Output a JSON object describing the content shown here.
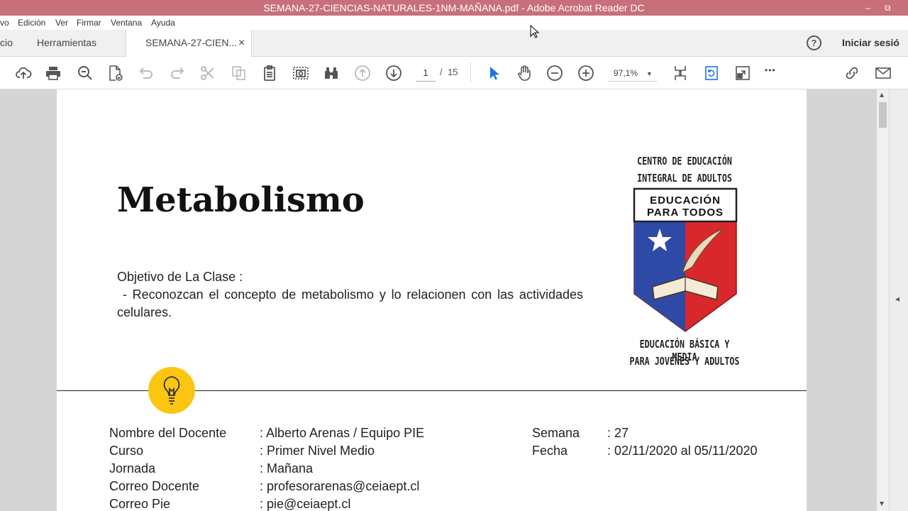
{
  "window": {
    "title": "SEMANA-27-CIENCIAS-NATURALES-1NM-MAÑANA.pdf - Adobe Acrobat Reader DC",
    "minimize_glyph": "–",
    "restore_glyph": "⧉"
  },
  "menu": {
    "items": [
      "vo",
      "Edición",
      "Ver",
      "Firmar",
      "Ventana",
      "Ayuda"
    ]
  },
  "tabs": {
    "home": "cio",
    "tools": "Herramientas",
    "doc": "SEMANA-27-CIEN...",
    "close_glyph": "×",
    "help_glyph": "?",
    "signin": "Iniciar sesió"
  },
  "toolbar": {
    "page_current": "1",
    "page_sep": "/",
    "page_total": "15",
    "zoom": "97,1%",
    "more_glyph": "•••"
  },
  "icons": {
    "upload": "cloud-upload-icon",
    "print": "printer-icon",
    "search": "search-icon",
    "edit_pdf": "edit-pdf-icon",
    "undo": "undo-icon",
    "redo": "redo-icon",
    "cut": "scissors-icon",
    "copy": "copy-icon",
    "paste": "clipboard-icon",
    "snapshot": "camera-icon",
    "find": "binoculars-icon",
    "prev_page": "arrow-up-circle-icon",
    "next_page": "arrow-down-circle-icon",
    "select": "cursor-arrow-icon",
    "hand": "hand-icon",
    "zoom_out": "minus-circle-icon",
    "zoom_in": "plus-circle-icon",
    "fit_page": "fit-page-icon",
    "rotate": "rotate-icon",
    "fullscreen": "fullscreen-icon",
    "share_link": "link-icon",
    "email": "envelope-icon",
    "bulb": "lightbulb-icon"
  },
  "colors": {
    "titlebar": "#c8707a",
    "accent_blue": "#1a73e8",
    "bulb_yellow": "#fbc612",
    "logo_blue": "#2e4aa6",
    "logo_red": "#d9282c"
  },
  "document": {
    "title": "Metabolismo",
    "objective_label": "Objetivo de La Clase :",
    "objective_text": " - Reconozcan el concepto de metabolismo y lo relacionen con las actividades celulares.",
    "logo": {
      "top1": "CENTRO DE EDUCACIÓN",
      "top2": "INTEGRAL DE ADULTOS",
      "banner1": "EDUCACIÓN",
      "banner2": "PARA TODOS",
      "bottom1": "EDUCACIÓN BÁSICA Y MEDIA",
      "bottom2": "PARA JOVENES Y ADULTOS"
    },
    "info": [
      {
        "label": "Nombre del Docente",
        "value": ": Alberto Arenas / Equipo PIE"
      },
      {
        "label": "Curso",
        "value": ": Primer Nivel Medio"
      },
      {
        "label": "Jornada",
        "value": ": Mañana"
      },
      {
        "label": "Correo Docente",
        "value": ": profesorarenas@ceiaept.cl"
      },
      {
        "label": "Correo Pie",
        "value": ": pie@ceiaept.cl"
      }
    ],
    "info_right": [
      {
        "label": "Semana",
        "value": ": 27"
      },
      {
        "label": "Fecha",
        "value": ": 02/11/2020 al 05/11/2020"
      }
    ]
  },
  "scroll": {
    "up_glyph": "▴",
    "down_glyph": "▾",
    "pane_glyph": "◂"
  }
}
